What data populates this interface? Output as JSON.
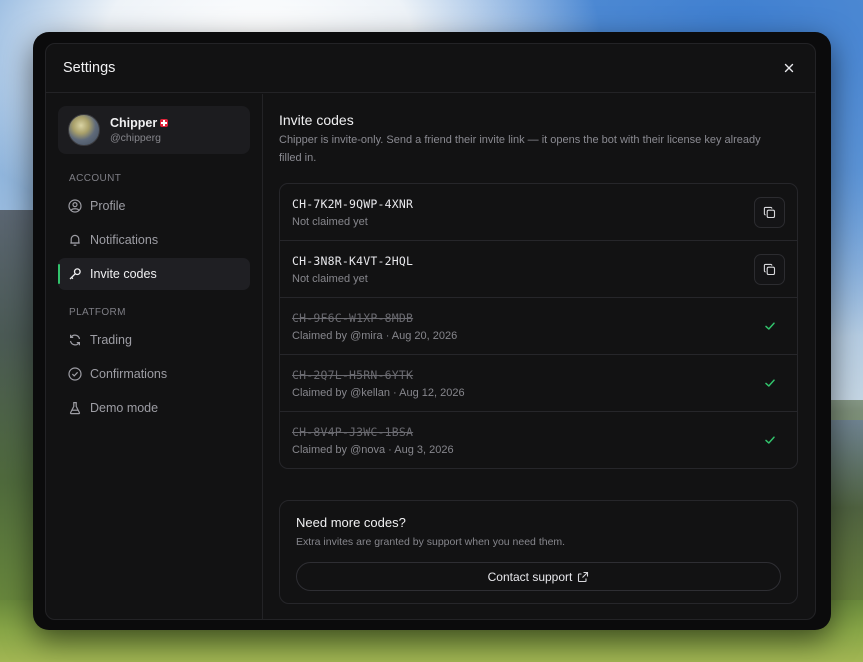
{
  "header": {
    "title": "Settings"
  },
  "profile": {
    "name": "Chipper",
    "handle": "@chipperg"
  },
  "sidebar": {
    "sections": [
      {
        "label": "ACCOUNT",
        "items": [
          {
            "label": "Profile",
            "icon": "user-circle-icon"
          },
          {
            "label": "Notifications",
            "icon": "bell-icon"
          },
          {
            "label": "Invite codes",
            "icon": "key-icon",
            "active": true
          }
        ]
      },
      {
        "label": "PLATFORM",
        "items": [
          {
            "label": "Trading",
            "icon": "refresh-icon"
          },
          {
            "label": "Confirmations",
            "icon": "check-circle-icon"
          },
          {
            "label": "Demo mode",
            "icon": "flask-icon"
          }
        ]
      }
    ]
  },
  "invite": {
    "title": "Invite codes",
    "description": "Chipper is invite-only. Send a friend their invite link — it opens the bot with their license key already filled in.",
    "codes": [
      {
        "code": "CH-7K2M-9QWP-4XNR",
        "status": "Not claimed yet",
        "claimed": false
      },
      {
        "code": "CH-3N8R-K4VT-2HQL",
        "status": "Not claimed yet",
        "claimed": false
      },
      {
        "code": "CH-9F6C-W1XP-8MDB",
        "status": "Claimed by @mira · Aug 20, 2026",
        "claimed": true
      },
      {
        "code": "CH-2Q7L-H5RN-6YTK",
        "status": "Claimed by @kellan · Aug 12, 2026",
        "claimed": true
      },
      {
        "code": "CH-8V4P-J3WC-1BSA",
        "status": "Claimed by @nova · Aug 3, 2026",
        "claimed": true
      }
    ]
  },
  "more": {
    "title": "Need more codes?",
    "description": "Extra invites are granted by support when you need them.",
    "button_label": "Contact support"
  },
  "colors": {
    "accent_green": "#32c36c",
    "panel_bg": "#121213",
    "border": "#232326"
  }
}
